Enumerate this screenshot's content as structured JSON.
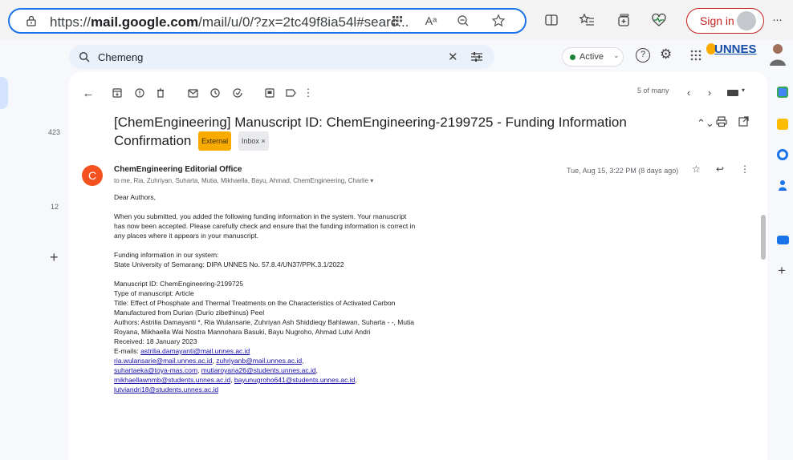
{
  "browser": {
    "url_prefix": "https://",
    "url_host": "mail.google.com",
    "url_path": "/mail/u/0/?zx=2tc49f8ia54l#searc...",
    "sign_in_label": "Sign in",
    "more_label": "···",
    "read_aloud_label": "Aᵃ"
  },
  "gmail": {
    "search_value": "Chemeng",
    "status_label": "Active",
    "org_label": "UNNES",
    "rail_counts": [
      "423",
      "12"
    ],
    "count_label": "5 of many"
  },
  "email": {
    "subject": "[ChemEngineering] Manuscript ID: ChemEngineering-2199725 - Funding Information Confirmation",
    "badge_external": "External",
    "badge_inbox": "Inbox ×",
    "avatar_letter": "C",
    "sender": "ChemEngineering Editorial Office",
    "recipients": "to me, Ria, Zuhriyan, Suharta, Mutia, Mikhaella, Bayu, Ahmad, ChemEngineering, Charlie ▾",
    "date": "Tue, Aug 15, 3:22 PM (8 days ago)",
    "greeting": "Dear Authors,",
    "p1": "When you submitted, you added the following funding information in the system. Your manuscript has now been accepted. Please carefully check and ensure that the funding information is correct in any places where it appears in your manuscript.",
    "funding_heading": "Funding information in our system:",
    "funding_value": "State University of Semarang: DIPA UNNES No. 57.8.4/UN37/PPK.3.1/2022",
    "ms_id": "Manuscript ID: ChemEngineering-2199725",
    "ms_type": "Type of manuscript: Article",
    "ms_title": "Title: Effect of Phosphate and Thermal Treatments on the Characteristics of Activated Carbon Manufactured from Durian (Durio zibethinus) Peel",
    "ms_authors": "Authors: Astrilia Damayanti *, Ria Wulansarie, Zuhriyan Ash Shiddieqy Bahlawan, Suharta - -, Mutia Royana, Mikhaella Wai Nostra Mannohara Basuki, Bayu Nugroho, Ahmad Lutvi Andri",
    "ms_received": "Received: 18 January 2023",
    "emails_label": "E-mails:",
    "emails": [
      "astrilia.damayanti@mail.unnes.ac.id",
      "ria.wulansarie@mail.unnes.ac.id",
      "zuhriyanb@mail.unnes.ac.id",
      "suhartaeka@toya-mas.com",
      "mutiaroyana26@students.unnes.ac.id",
      "mikhaellawnmb@students.unnes.ac.id",
      "bayunugroho641@students.unnes.ac.id",
      "lutviandri18@students.unnes.ac.id"
    ]
  },
  "colors": {
    "accent": "#1a73e8",
    "sign_in": "#c5221f",
    "avatar": "#f4511e",
    "external_badge": "#f9ab00"
  },
  "icons": [
    "lock-icon",
    "apps-icon",
    "read-aloud-icon",
    "zoom-icon",
    "favorite-icon",
    "split-screen-icon",
    "favorites-icon",
    "collections-icon",
    "performance-icon",
    "search-icon",
    "close-icon",
    "filter-icon",
    "help-icon",
    "settings-icon",
    "apps-grid-icon",
    "back-icon",
    "archive-icon",
    "report-icon",
    "delete-icon",
    "mark-unread-icon",
    "snooze-icon",
    "add-task-icon",
    "move-icon",
    "label-icon",
    "more-icon",
    "prev-icon",
    "next-icon",
    "keyboard-icon",
    "expand-icon",
    "print-icon",
    "popout-icon",
    "star-icon",
    "reply-icon",
    "compose-icon",
    "calendar-icon",
    "keep-icon",
    "tasks-icon",
    "contacts-icon",
    "meet-icon",
    "add-icon"
  ]
}
